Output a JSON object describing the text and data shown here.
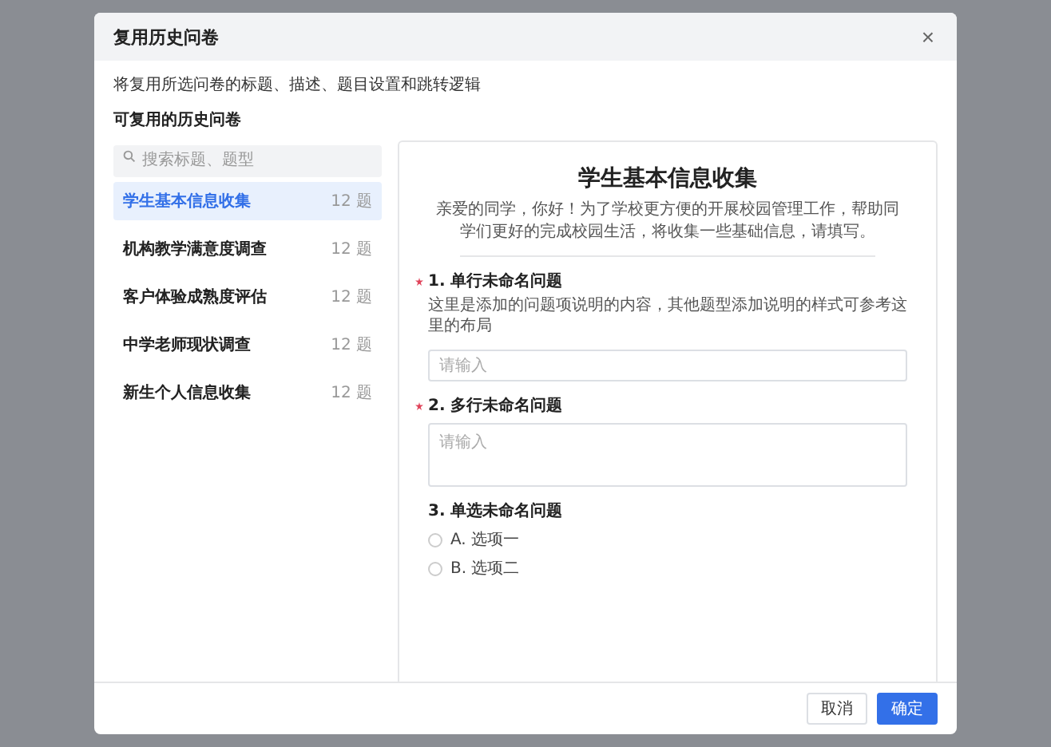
{
  "dialog": {
    "title": "复用历史问卷",
    "close": "×",
    "description": "将复用所选问卷的标题、描述、题目设置和跳转逻辑",
    "section_label": "可复用的历史问卷"
  },
  "search": {
    "placeholder": "搜索标题、题型"
  },
  "surveys": [
    {
      "name": "学生基本信息收集",
      "count": "12 题",
      "selected": true
    },
    {
      "name": "机构教学满意度调查",
      "count": "12 题",
      "selected": false
    },
    {
      "name": "客户体验成熟度评估",
      "count": "12 题",
      "selected": false
    },
    {
      "name": "中学老师现状调查",
      "count": "12 题",
      "selected": false
    },
    {
      "name": "新生个人信息收集",
      "count": "12 题",
      "selected": false
    }
  ],
  "preview": {
    "title": "学生基本信息收集",
    "intro": "亲爱的同学，你好！为了学校更方便的开展校园管理工作，帮助同学们更好的完成校园生活，将收集一些基础信息，请填写。",
    "questions": [
      {
        "kind": "text",
        "required": true,
        "title": "1. 单行未命名问题",
        "description": "这里是添加的问题项说明的内容，其他题型添加说明的样式可参考这里的布局",
        "placeholder": "请输入"
      },
      {
        "kind": "textarea",
        "required": true,
        "title": "2. 多行未命名问题",
        "placeholder": "请输入"
      },
      {
        "kind": "radio",
        "required": false,
        "title": "3. 单选未命名问题",
        "options": [
          {
            "label": "A. 选项一",
            "selected": false
          },
          {
            "label": "B. 选项二",
            "selected": false
          }
        ]
      }
    ]
  },
  "buttons": [
    {
      "label": "取消",
      "kind": "secondary"
    },
    {
      "label": "确定",
      "kind": "primary"
    }
  ]
}
